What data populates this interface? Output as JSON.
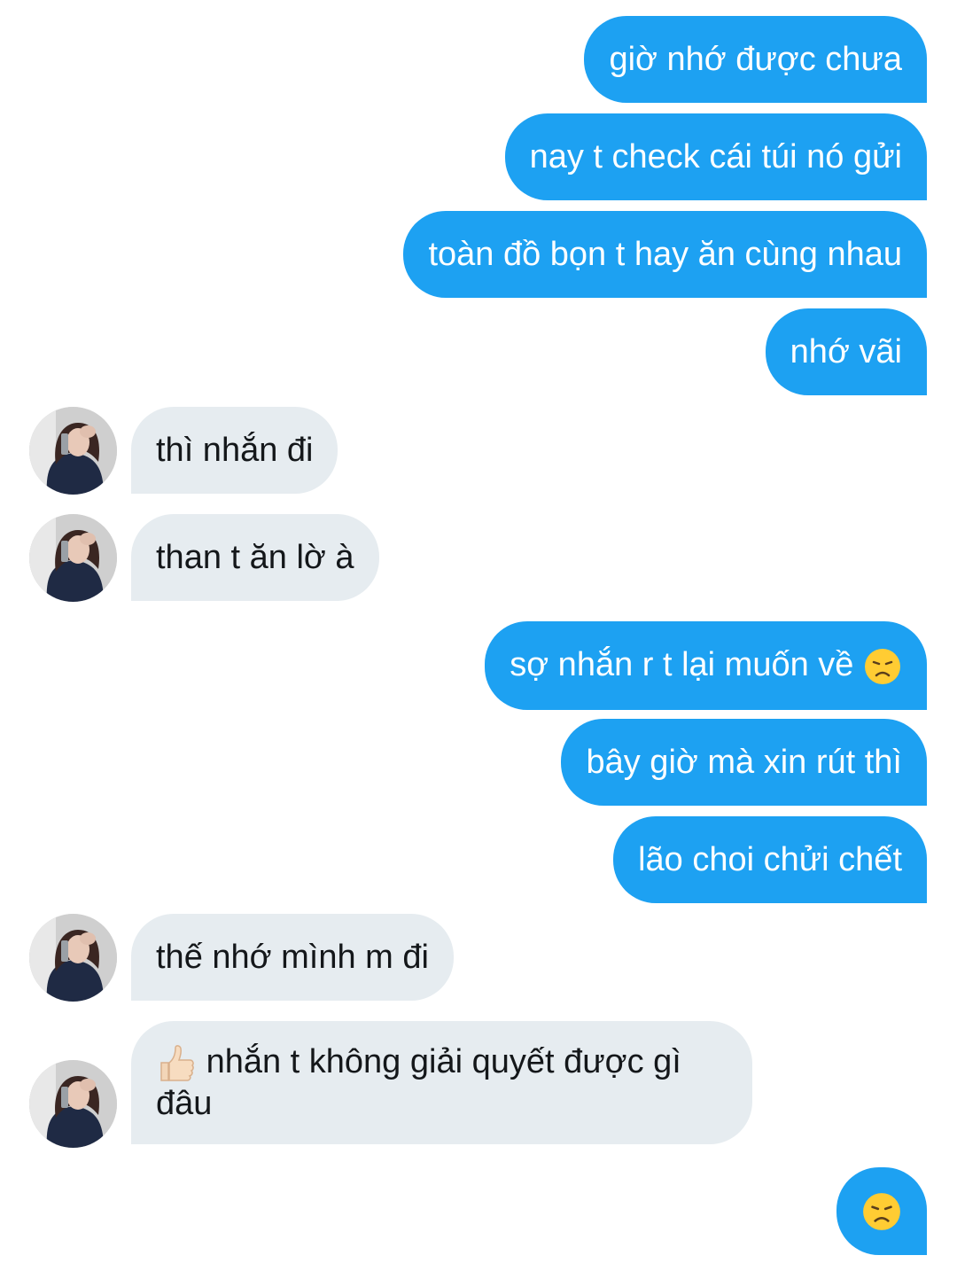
{
  "conversation": {
    "messages": [
      {
        "direction": "sent",
        "text": "giờ nhớ được chưa"
      },
      {
        "direction": "sent",
        "text": "nay t check cái túi nó gửi"
      },
      {
        "direction": "sent",
        "text": "toàn đồ bọn t hay ăn cùng nhau"
      },
      {
        "direction": "sent",
        "text": "nhớ vãi"
      },
      {
        "direction": "received",
        "text": "thì nhắn đi"
      },
      {
        "direction": "received",
        "text": "than t ăn lờ à"
      },
      {
        "direction": "sent",
        "text": "sợ nhắn r t lại muốn về",
        "emoji": "disappointed-face-icon"
      },
      {
        "direction": "sent",
        "text": "bây giờ mà xin rút thì"
      },
      {
        "direction": "sent",
        "text": "lão choi chửi chết"
      },
      {
        "direction": "received",
        "text": "thế nhớ mình m đi"
      },
      {
        "direction": "received",
        "text": "nhắn t không giải quyết được gì đâu",
        "emoji": "thumbs-up-icon"
      },
      {
        "direction": "sent",
        "text": "",
        "emoji": "disappointed-face-icon"
      }
    ]
  },
  "colors": {
    "sent_bubble": "#1da1f2",
    "sent_text": "#ffffff",
    "received_bubble": "#e6ecf0",
    "received_text": "#14171a",
    "background": "#ffffff"
  }
}
